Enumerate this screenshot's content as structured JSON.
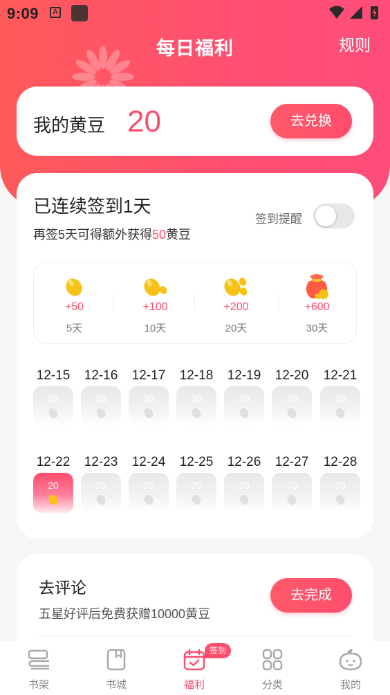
{
  "status_bar": {
    "time": "9:09",
    "a_icon_letter": "A"
  },
  "header": {
    "title": "每日福利",
    "rules_label": "规则"
  },
  "beans": {
    "label": "我的黄豆",
    "value": "20",
    "exchange_label": "去兑换"
  },
  "checkin": {
    "title": "已连续签到1天",
    "subtitle_prefix": "再签5天可得额外获得",
    "subtitle_amount": "50",
    "subtitle_suffix": "黄豆",
    "reminder_label": "签到提醒",
    "reminder_on": false,
    "milestones": [
      {
        "reward": "+50",
        "days": "5天",
        "icon": "single-bean-icon"
      },
      {
        "reward": "+100",
        "days": "10天",
        "icon": "two-beans-icon"
      },
      {
        "reward": "+200",
        "days": "20天",
        "icon": "bean-pile-icon"
      },
      {
        "reward": "+600",
        "days": "30天",
        "icon": "bean-bag-icon"
      }
    ],
    "week1": [
      {
        "date": "12-15",
        "reward": "20"
      },
      {
        "date": "12-16",
        "reward": "20"
      },
      {
        "date": "12-17",
        "reward": "20"
      },
      {
        "date": "12-18",
        "reward": "20"
      },
      {
        "date": "12-19",
        "reward": "20"
      },
      {
        "date": "12-20",
        "reward": "20"
      },
      {
        "date": "12-21",
        "reward": "20"
      }
    ],
    "week2": [
      {
        "date": "12-22",
        "reward": "20",
        "active": true
      },
      {
        "date": "12-23",
        "reward": "20"
      },
      {
        "date": "12-24",
        "reward": "20"
      },
      {
        "date": "12-25",
        "reward": "20"
      },
      {
        "date": "12-26",
        "reward": "20"
      },
      {
        "date": "12-27",
        "reward": "70"
      },
      {
        "date": "12-28",
        "reward": "70"
      }
    ]
  },
  "task": {
    "title": "去评论",
    "subtitle": "五星好评后免费获赠10000黄豆",
    "button_label": "去完成"
  },
  "tabbar": {
    "items": [
      {
        "label": "书架",
        "icon": "bookshelf-icon"
      },
      {
        "label": "书城",
        "icon": "bookstore-icon"
      },
      {
        "label": "福利",
        "icon": "calendar-check-icon",
        "active": true
      },
      {
        "label": "分类",
        "icon": "category-grid-icon"
      },
      {
        "label": "我的",
        "icon": "profile-face-icon"
      }
    ],
    "badge": "签到"
  },
  "colors": {
    "accent": "#ff4d6d",
    "header_gradient_start": "#ff5a5a",
    "header_gradient_end": "#ff4d7a",
    "bean": "#f8c117"
  }
}
